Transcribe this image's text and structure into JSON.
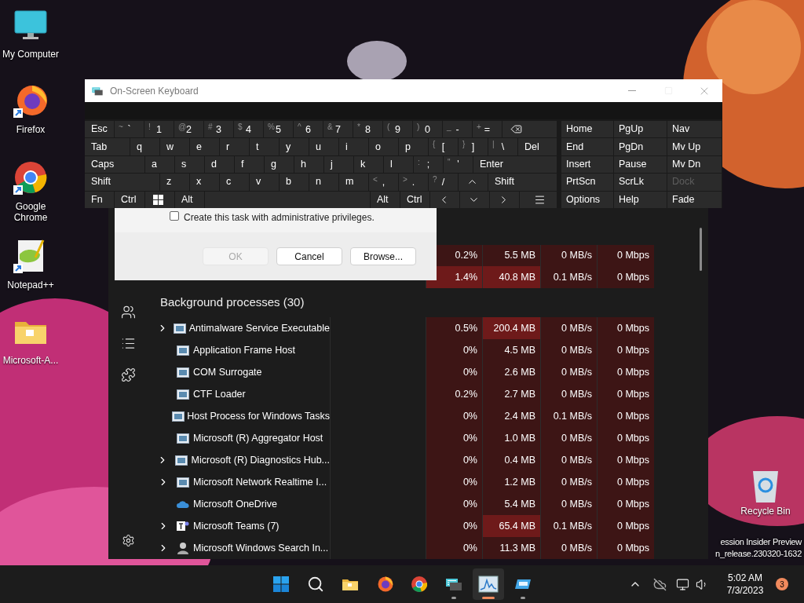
{
  "desktop_icons": [
    {
      "label": "My Computer",
      "kind": "monitor",
      "shortcut": false
    },
    {
      "label": "Firefox",
      "kind": "firefox",
      "shortcut": true
    },
    {
      "label": "Google Chrome",
      "kind": "chrome",
      "shortcut": true
    },
    {
      "label": "Notepad++",
      "kind": "notepad",
      "shortcut": true
    },
    {
      "label": "Microsoft-A...",
      "kind": "folder",
      "shortcut": false
    }
  ],
  "recycle_bin": {
    "label": "Recycle Bin"
  },
  "build_info": [
    "ession Insider Preview",
    "n_release.230320-1632"
  ],
  "task_manager": {
    "top_rows": [
      {
        "cpu": "0.2%",
        "memory": "5.5 MB",
        "disk": "0 MB/s",
        "network": "0 Mbps",
        "cpu_hot": false,
        "memory_hot": false
      },
      {
        "cpu": "1.4%",
        "memory": "40.8 MB",
        "disk": "0.1 MB/s",
        "network": "0 Mbps",
        "cpu_hot": true,
        "memory_hot": true
      }
    ],
    "group_title": "Background processes (30)",
    "rows": [
      {
        "name": "Antimalware Service Executable",
        "kind": "window",
        "has_children": true,
        "cpu": "0.5%",
        "memory": "200.4 MB",
        "disk": "0 MB/s",
        "network": "0 Mbps",
        "cpu_hot": false,
        "memory_hot": true
      },
      {
        "name": "Application Frame Host",
        "kind": "window",
        "has_children": false,
        "cpu": "0%",
        "memory": "4.5 MB",
        "disk": "0 MB/s",
        "network": "0 Mbps",
        "cpu_hot": false,
        "memory_hot": false
      },
      {
        "name": "COM Surrogate",
        "kind": "window",
        "has_children": false,
        "cpu": "0%",
        "memory": "2.6 MB",
        "disk": "0 MB/s",
        "network": "0 Mbps",
        "cpu_hot": false,
        "memory_hot": false
      },
      {
        "name": "CTF Loader",
        "kind": "window",
        "has_children": false,
        "cpu": "0.2%",
        "memory": "2.7 MB",
        "disk": "0 MB/s",
        "network": "0 Mbps",
        "cpu_hot": false,
        "memory_hot": false
      },
      {
        "name": "Host Process for Windows Tasks",
        "kind": "window",
        "has_children": false,
        "cpu": "0%",
        "memory": "2.4 MB",
        "disk": "0.1 MB/s",
        "network": "0 Mbps",
        "cpu_hot": false,
        "memory_hot": false
      },
      {
        "name": "Microsoft (R) Aggregator Host",
        "kind": "window",
        "has_children": false,
        "cpu": "0%",
        "memory": "1.0 MB",
        "disk": "0 MB/s",
        "network": "0 Mbps",
        "cpu_hot": false,
        "memory_hot": false
      },
      {
        "name": "Microsoft (R) Diagnostics Hub...",
        "kind": "window",
        "has_children": true,
        "cpu": "0%",
        "memory": "0.4 MB",
        "disk": "0 MB/s",
        "network": "0 Mbps",
        "cpu_hot": false,
        "memory_hot": false
      },
      {
        "name": "Microsoft Network Realtime I...",
        "kind": "window",
        "has_children": true,
        "cpu": "0%",
        "memory": "1.2 MB",
        "disk": "0 MB/s",
        "network": "0 Mbps",
        "cpu_hot": false,
        "memory_hot": false
      },
      {
        "name": "Microsoft OneDrive",
        "kind": "cloud",
        "has_children": false,
        "cpu": "0%",
        "memory": "5.4 MB",
        "disk": "0 MB/s",
        "network": "0 Mbps",
        "cpu_hot": false,
        "memory_hot": false
      },
      {
        "name": "Microsoft Teams (7)",
        "kind": "teams",
        "has_children": true,
        "cpu": "0%",
        "memory": "65.4 MB",
        "disk": "0.1 MB/s",
        "network": "0 Mbps",
        "cpu_hot": false,
        "memory_hot": true
      },
      {
        "name": "Microsoft Windows Search In...",
        "kind": "person",
        "has_children": true,
        "cpu": "0%",
        "memory": "11.3 MB",
        "disk": "0 MB/s",
        "network": "0 Mbps",
        "cpu_hot": false,
        "memory_hot": false
      }
    ]
  },
  "dialog": {
    "checkbox": {
      "label": "Create this task with administrative privileges.",
      "checked": false
    },
    "buttons": [
      {
        "label": "OK",
        "disabled": true
      },
      {
        "label": "Cancel",
        "disabled": false
      },
      {
        "label": "Browse...",
        "disabled": false
      }
    ]
  },
  "keyboard": {
    "title": "On-Screen Keyboard",
    "rows": [
      {
        "keys": [
          {
            "kind": "text",
            "label": "Esc"
          },
          {
            "kind": "char",
            "shift": "~",
            "label": "`"
          },
          {
            "kind": "char",
            "shift": "!",
            "label": "1"
          },
          {
            "kind": "char",
            "shift": "@",
            "label": "2"
          },
          {
            "kind": "char",
            "shift": "#",
            "label": "3"
          },
          {
            "kind": "char",
            "shift": "$",
            "label": "4"
          },
          {
            "kind": "char",
            "shift": "%",
            "label": "5"
          },
          {
            "kind": "char",
            "shift": "^",
            "label": "6"
          },
          {
            "kind": "char",
            "shift": "&",
            "label": "7"
          },
          {
            "kind": "char",
            "shift": "*",
            "label": "8"
          },
          {
            "kind": "char",
            "shift": "(",
            "label": "9"
          },
          {
            "kind": "char",
            "shift": ")",
            "label": "0"
          },
          {
            "kind": "char",
            "shift": "_",
            "label": "-"
          },
          {
            "kind": "char",
            "shift": "+",
            "label": "="
          },
          {
            "kind": "backspace"
          }
        ]
      },
      {
        "keys": [
          {
            "kind": "text",
            "label": "Tab"
          },
          {
            "kind": "text",
            "label": "q"
          },
          {
            "kind": "text",
            "label": "w"
          },
          {
            "kind": "text",
            "label": "e"
          },
          {
            "kind": "text",
            "label": "r"
          },
          {
            "kind": "text",
            "label": "t"
          },
          {
            "kind": "text",
            "label": "y"
          },
          {
            "kind": "text",
            "label": "u"
          },
          {
            "kind": "text",
            "label": "i"
          },
          {
            "kind": "text",
            "label": "o"
          },
          {
            "kind": "text",
            "label": "p"
          },
          {
            "kind": "char",
            "shift": "{",
            "label": "["
          },
          {
            "kind": "char",
            "shift": "}",
            "label": "]"
          },
          {
            "kind": "char",
            "shift": "|",
            "label": "\\"
          },
          {
            "kind": "text",
            "label": "Del"
          }
        ]
      },
      {
        "keys": [
          {
            "kind": "text",
            "label": "Caps"
          },
          {
            "kind": "text",
            "label": "a"
          },
          {
            "kind": "text",
            "label": "s"
          },
          {
            "kind": "text",
            "label": "d"
          },
          {
            "kind": "text",
            "label": "f"
          },
          {
            "kind": "text",
            "label": "g"
          },
          {
            "kind": "text",
            "label": "h"
          },
          {
            "kind": "text",
            "label": "j"
          },
          {
            "kind": "text",
            "label": "k"
          },
          {
            "kind": "text",
            "label": "l"
          },
          {
            "kind": "char",
            "shift": ":",
            "label": ";"
          },
          {
            "kind": "char",
            "shift": "\"",
            "label": "'"
          },
          {
            "kind": "text",
            "label": "Enter"
          }
        ]
      },
      {
        "keys": [
          {
            "kind": "text",
            "label": "Shift"
          },
          {
            "kind": "text",
            "label": "z"
          },
          {
            "kind": "text",
            "label": "x"
          },
          {
            "kind": "text",
            "label": "c"
          },
          {
            "kind": "text",
            "label": "v"
          },
          {
            "kind": "text",
            "label": "b"
          },
          {
            "kind": "text",
            "label": "n"
          },
          {
            "kind": "text",
            "label": "m"
          },
          {
            "kind": "char",
            "shift": "<",
            "label": ","
          },
          {
            "kind": "char",
            "shift": ">",
            "label": "."
          },
          {
            "kind": "char",
            "shift": "?",
            "label": "/"
          },
          {
            "kind": "up"
          },
          {
            "kind": "text",
            "label": "Shift"
          }
        ]
      },
      {
        "keys": [
          {
            "kind": "text",
            "label": "Fn"
          },
          {
            "kind": "text",
            "label": "Ctrl"
          },
          {
            "kind": "windows"
          },
          {
            "kind": "text",
            "label": "Alt"
          },
          {
            "kind": "space"
          },
          {
            "kind": "text",
            "label": "Alt"
          },
          {
            "kind": "text",
            "label": "Ctrl"
          },
          {
            "kind": "left"
          },
          {
            "kind": "down"
          },
          {
            "kind": "right"
          },
          {
            "kind": "menu"
          }
        ]
      }
    ],
    "side_rows": [
      {
        "keys": [
          {
            "label": "Home",
            "disabled": false
          },
          {
            "label": "PgUp",
            "disabled": false
          },
          {
            "label": "Nav",
            "disabled": false
          }
        ]
      },
      {
        "keys": [
          {
            "label": "End",
            "disabled": false
          },
          {
            "label": "PgDn",
            "disabled": false
          },
          {
            "label": "Mv Up",
            "disabled": false
          }
        ]
      },
      {
        "keys": [
          {
            "label": "Insert",
            "disabled": false
          },
          {
            "label": "Pause",
            "disabled": false
          },
          {
            "label": "Mv Dn",
            "disabled": false
          }
        ]
      },
      {
        "keys": [
          {
            "label": "PrtScn",
            "disabled": false
          },
          {
            "label": "ScrLk",
            "disabled": false
          },
          {
            "label": "Dock",
            "disabled": true
          }
        ]
      },
      {
        "keys": [
          {
            "label": "Options",
            "disabled": false
          },
          {
            "label": "Help",
            "disabled": false
          },
          {
            "label": "Fade",
            "disabled": false
          }
        ]
      }
    ]
  },
  "taskbar": {
    "apps": [
      {
        "kind": "start",
        "running": false,
        "active": false
      },
      {
        "kind": "search",
        "running": false,
        "active": false
      },
      {
        "kind": "folder",
        "running": false,
        "active": false
      },
      {
        "kind": "firefox",
        "running": false,
        "active": false
      },
      {
        "kind": "chrome",
        "running": false,
        "active": false
      },
      {
        "kind": "keyboard",
        "running": true,
        "active": false
      },
      {
        "kind": "monitor",
        "running": true,
        "active": true
      },
      {
        "kind": "remote",
        "running": true,
        "active": false
      }
    ],
    "clock": {
      "time": "5:02 AM",
      "date": "7/3/2023"
    },
    "notification_count": "3"
  }
}
